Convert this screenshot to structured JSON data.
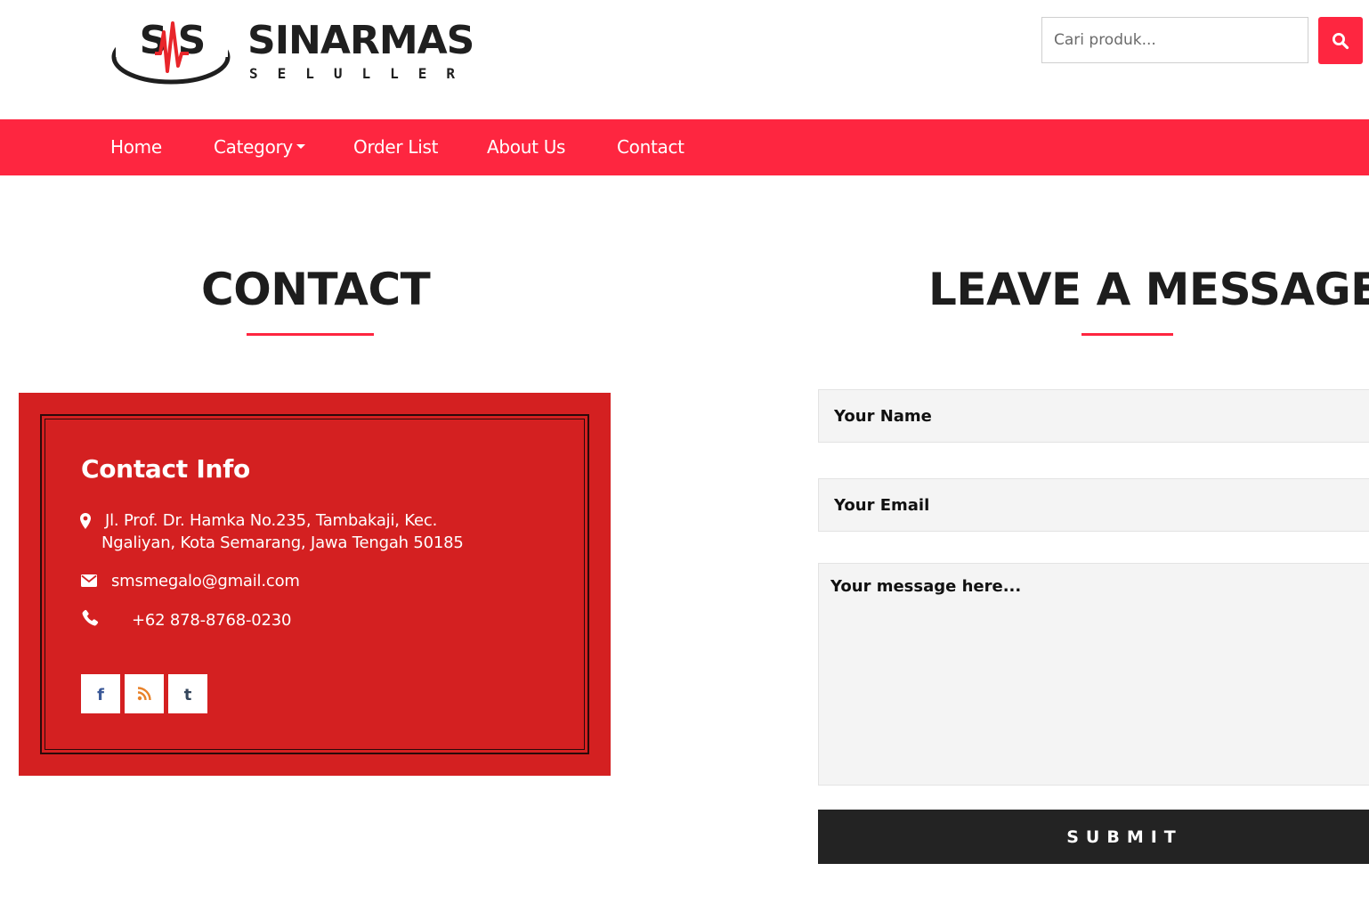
{
  "brand": {
    "name": "SINARMAS",
    "tagline": "SELULLER",
    "mark_text": "SMS",
    "colors": {
      "accent": "#fe2640",
      "card_red": "#d42021",
      "dark": "#232323"
    }
  },
  "search": {
    "placeholder": "Cari produk...",
    "button_icon": "search-icon"
  },
  "nav": {
    "items": [
      {
        "label": "Home"
      },
      {
        "label": "Category",
        "has_dropdown": true
      },
      {
        "label": "Order List"
      },
      {
        "label": "About Us"
      },
      {
        "label": "Contact"
      }
    ]
  },
  "contact": {
    "heading": "CONTACT",
    "card_title": "Contact Info",
    "address_line1": "Jl. Prof. Dr. Hamka No.235, Tambakaji, Kec.",
    "address_line2": "Ngaliyan, Kota Semarang, Jawa Tengah 50185",
    "email": "smsmegalo@gmail.com",
    "phone": "+62 878-8768-0230",
    "social": [
      {
        "icon": "facebook-icon",
        "glyph": "f",
        "color": "#3b5998"
      },
      {
        "icon": "rss-icon",
        "color": "#e8822a"
      },
      {
        "icon": "tumblr-icon",
        "glyph": "t",
        "color": "#35465c"
      }
    ]
  },
  "form": {
    "heading": "LEAVE A MESSAGE",
    "name_placeholder": "Your Name",
    "email_placeholder": "Your Email",
    "message_placeholder": "Your message here...",
    "submit_label": "SUBMIT"
  }
}
